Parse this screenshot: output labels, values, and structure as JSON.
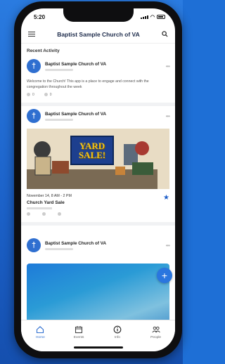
{
  "status": {
    "time": "5:20"
  },
  "header": {
    "title": "Baptist Sample Church of VA",
    "menu_icon": "menu-icon",
    "search_icon": "search-icon"
  },
  "feed": {
    "section_title": "Recent Activity",
    "posts": [
      {
        "author": "Baptist Sample Church of VA",
        "avatar_glyph": "†",
        "body": "Welcome to the Church! This app is a place to engage and connect with the congregation throughout the week",
        "reactions": [
          "0",
          "0"
        ]
      },
      {
        "author": "Baptist Sample Church of VA",
        "avatar_glyph": "†",
        "image_text_1": "YARD",
        "image_text_2": "SALE!",
        "event_date": "November 14, 8 AM - 2 PM",
        "event_title": "Church Yard Sale"
      },
      {
        "author": "Baptist Sample Church of VA",
        "avatar_glyph": "†"
      }
    ]
  },
  "fab": {
    "label": "+"
  },
  "tabs": [
    {
      "label": "Home",
      "icon": "home-icon",
      "active": true
    },
    {
      "label": "Events",
      "icon": "calendar-icon",
      "active": false
    },
    {
      "label": "Info",
      "icon": "info-icon",
      "active": false
    },
    {
      "label": "People",
      "icon": "people-icon",
      "active": false
    }
  ],
  "colors": {
    "brand": "#2f6fd0",
    "background": "#1e6fd6"
  }
}
